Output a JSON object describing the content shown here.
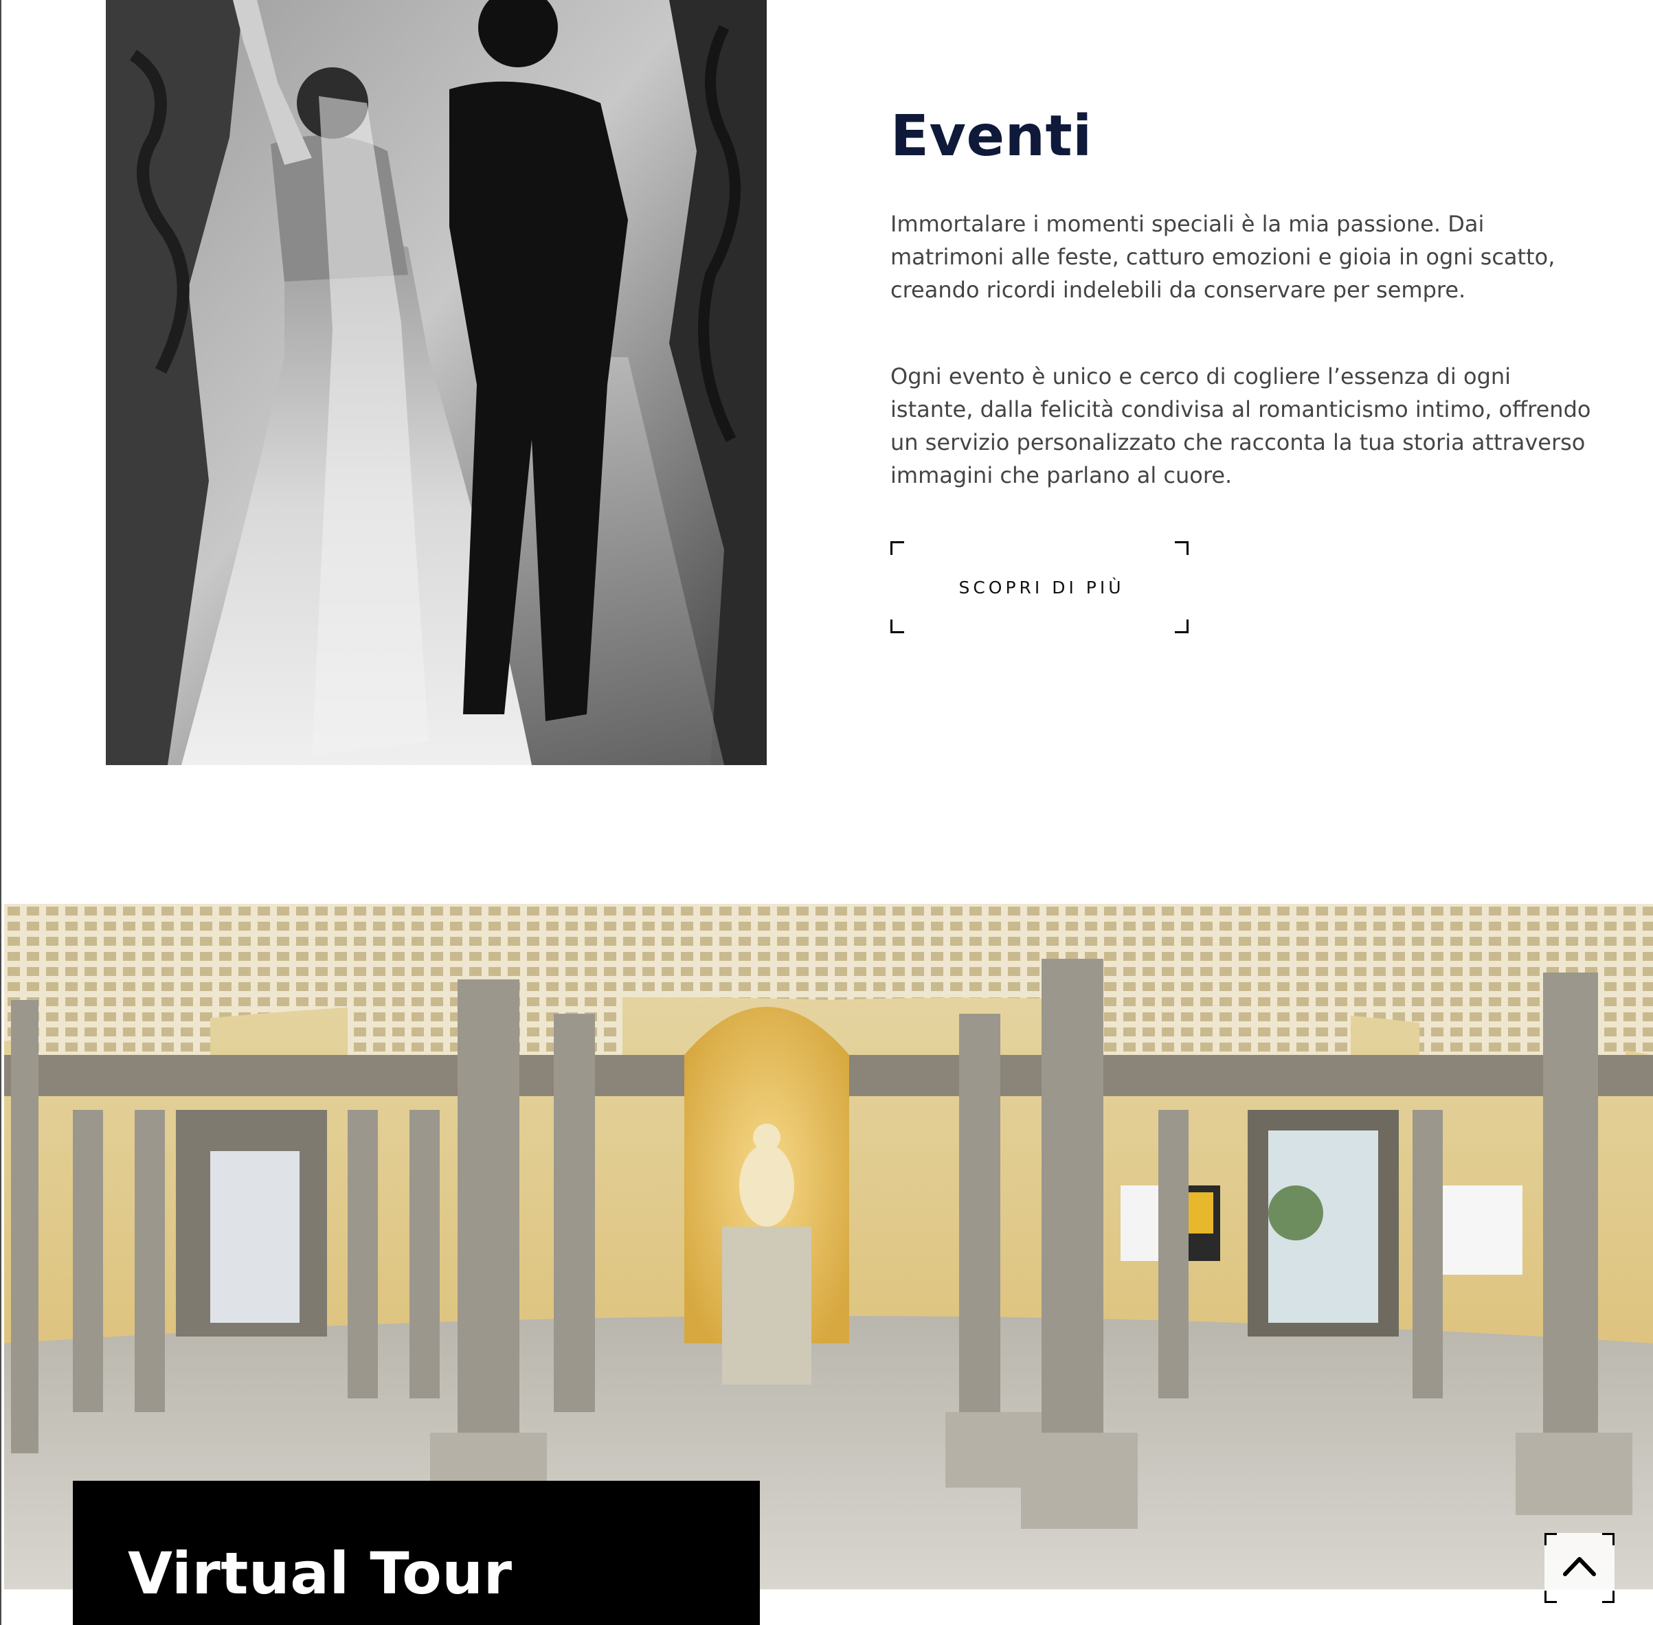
{
  "events": {
    "title": "Eventi",
    "paragraph_1": "Immortalare i momenti speciali è la mia passione. Dai matrimoni alle feste, catturo emozioni e gioia in ogni scatto, creando ricordi indelebili da conservare per sempre.",
    "paragraph_2": "Ogni evento è unico e cerco di cogliere l’essenza di ogni istante, dalla felicità condivisa al romanticismo intimo, offrendo un servizio personalizzato che racconta la tua storia attraverso immagini che parlano al cuore.",
    "button_label": "SCOPRI DI PIÙ",
    "photo_icon": "wedding-couple-photo"
  },
  "virtual_tour": {
    "title": "Virtual Tour",
    "photo_icon": "panorama-courtyard-photo"
  },
  "scroll_top_icon": "chevron-up-icon",
  "colors": {
    "title": "#0f1a3a",
    "body_text": "#444444",
    "tour_box": "#000000",
    "tour_text": "#ffffff"
  }
}
